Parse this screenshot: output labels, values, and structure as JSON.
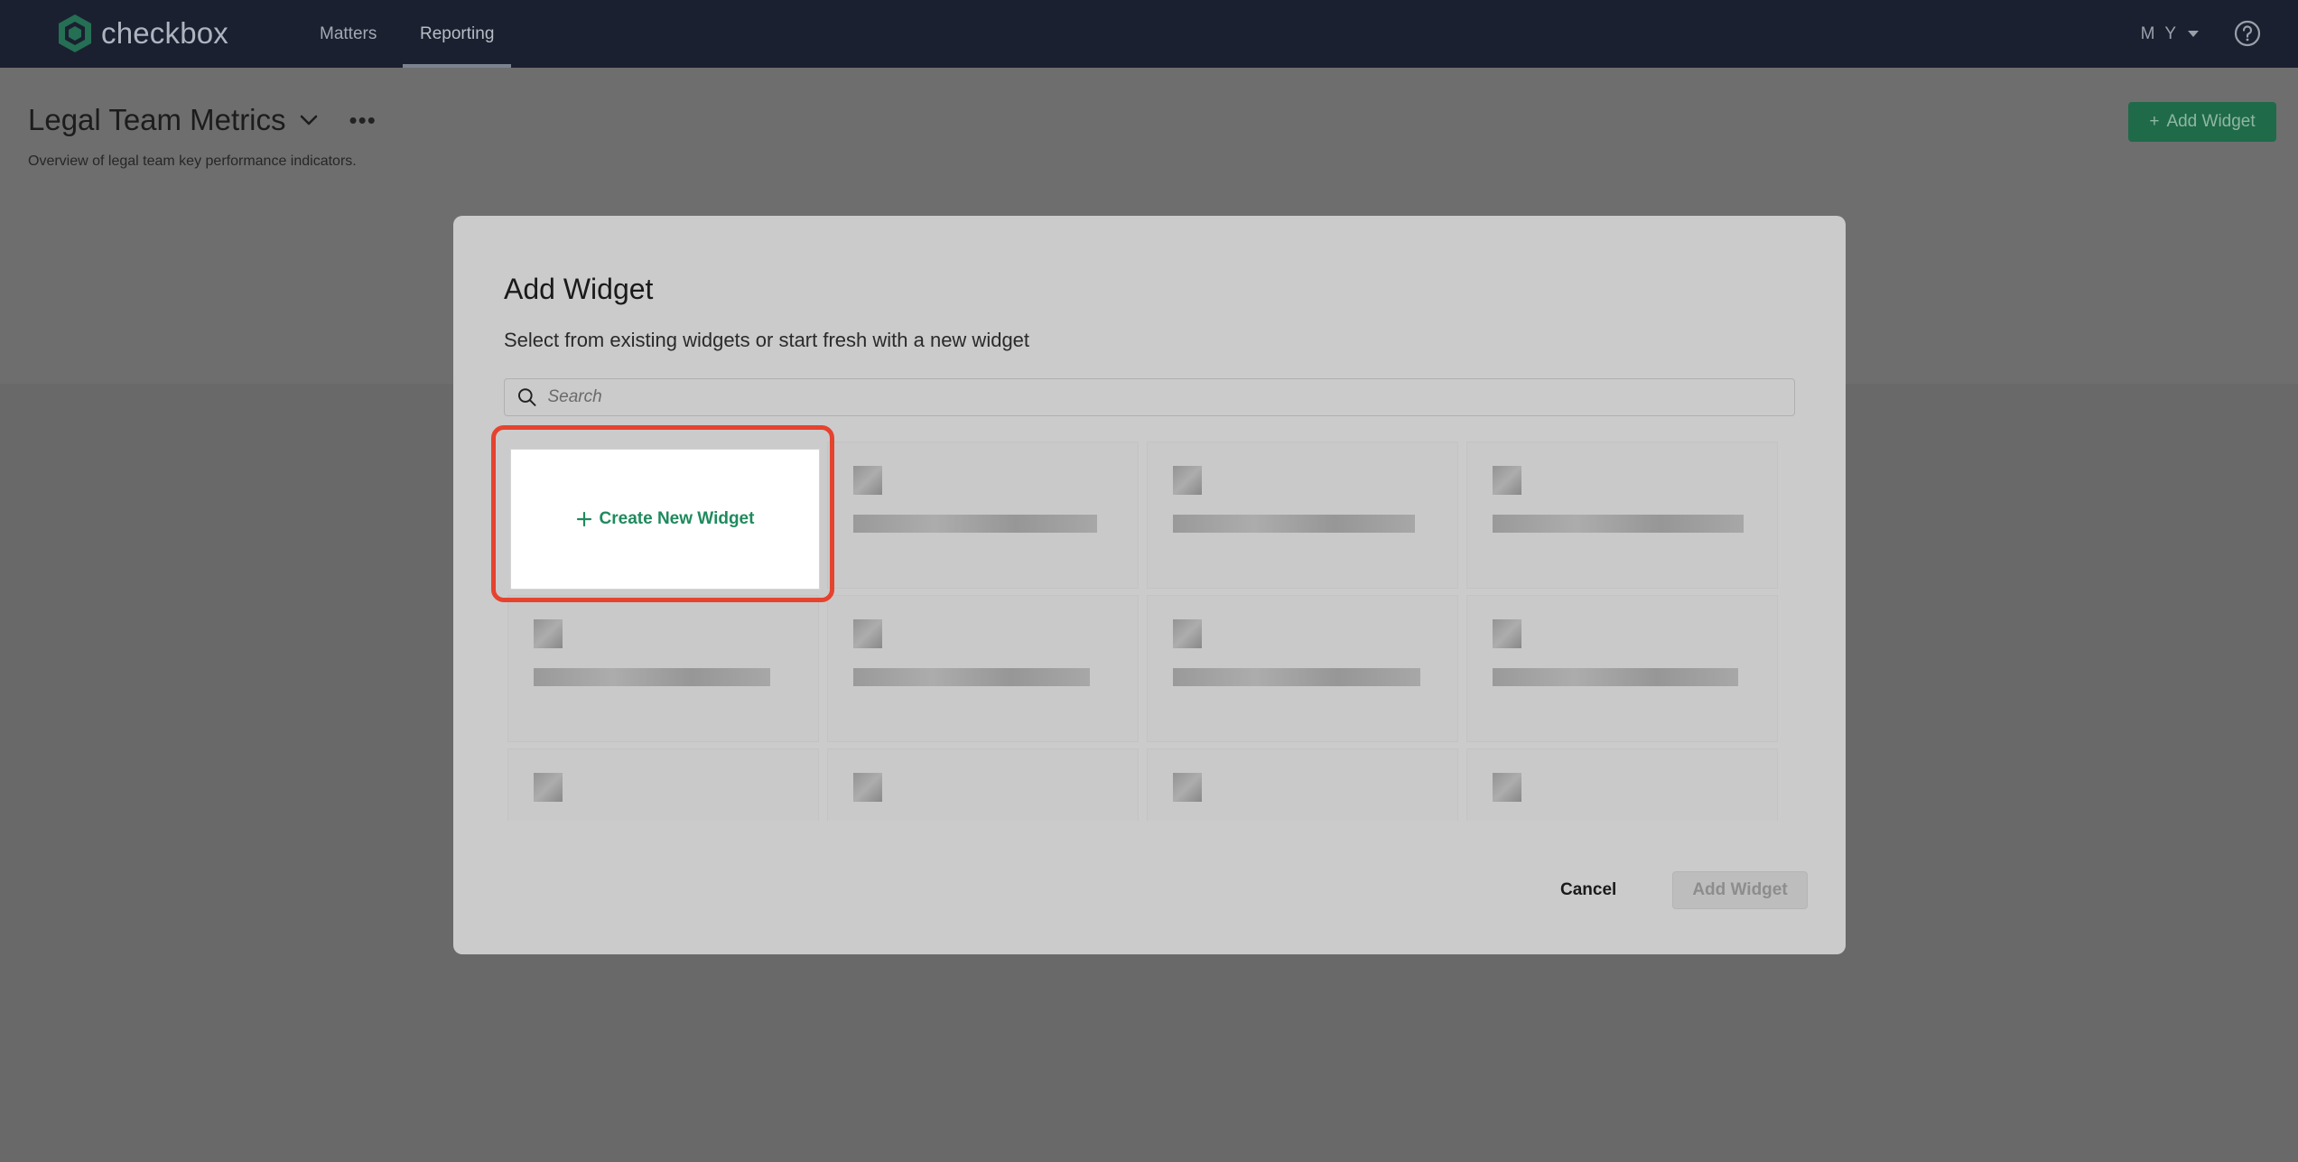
{
  "app": {
    "brand": "checkbox"
  },
  "nav": {
    "items": [
      {
        "label": "Matters",
        "active": false
      },
      {
        "label": "Reporting",
        "active": true
      }
    ],
    "user_initials": "M Y"
  },
  "page": {
    "title": "Legal Team Metrics",
    "subtitle": "Overview of legal team key performance indicators.",
    "add_widget_label": "Add Widget"
  },
  "modal": {
    "title": "Add Widget",
    "subtitle": "Select from existing widgets or start fresh with a new widget",
    "search_placeholder": "Search",
    "create_label": "Create New Widget",
    "cancel_label": "Cancel",
    "add_label": "Add Widget"
  },
  "colors": {
    "brand_green": "#1f8a5e",
    "highlight": "#e5432e",
    "nav_bg": "#1a2030"
  }
}
